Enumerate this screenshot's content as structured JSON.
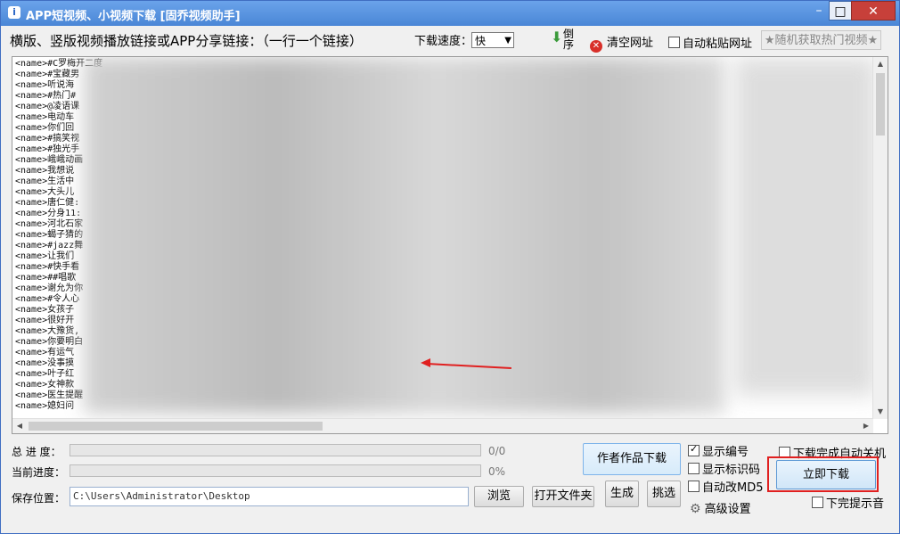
{
  "window": {
    "title": "APP短视频、小视频下载 [固乔视频助手]",
    "controls": {
      "minimize": "–",
      "maximize": "□",
      "close": "✕"
    },
    "icon": "app-icon"
  },
  "toolbar": {
    "main_label": "横版、竖版视频播放链接或APP分享链接：（一行一个链接）",
    "speed_label": "下载速度：",
    "speed_value": "快",
    "reverse_label": "倒序",
    "clear_label": "清空网址",
    "auto_paste_label": "自动粘贴网址",
    "auto_paste_checked": false,
    "hot_label": "★随机获取热门视频★"
  },
  "links": {
    "rows": [
      "<name>#C罗梅开二度",
      "<name>#宝藏男",
      "<name>听说海",
      "<name>#热门#",
      "<name>@凌语课",
      "<name>电动车",
      "<name>你们回",
      "<name>#搞笑视",
      "<name>#独光手",
      "<name>峨峨动画",
      "<name>我想说",
      "<name>生活中",
      "<name>大头儿",
      "<name>唐仁健:",
      "<name>分身11:",
      "<name>河北石家",
      "<name>蝎子猜的",
      "<name>#jazz舞",
      "<name>让我们",
      "<name>#快手看",
      "<name>##唱歌",
      "<name>谢允为你",
      "<name>#令人心",
      "<name>女孩子",
      "<name>很好开",
      "<name>大豫货,",
      "<name>你要明白",
      "<name>有运气",
      "<name>没事摸",
      "<name>叶子红",
      "<name>女神款",
      "<name>医生提醒",
      "<name>媳妇问"
    ]
  },
  "progress": {
    "total_label": "总 进 度：",
    "total_text": "0/0",
    "total_fraction": 0,
    "current_label": "当前进度：",
    "current_text": "0%",
    "current_fraction": 0
  },
  "save": {
    "label": "保存位置：",
    "path": "C:\\Users\\Administrator\\Desktop",
    "browse": "浏览",
    "open_folder": "打开文件夹"
  },
  "actions": {
    "author_download": "作者作品下载",
    "generate": "生成",
    "pick": "挑选",
    "download_now": "立即下载"
  },
  "options": {
    "show_number": {
      "label": "显示编号",
      "checked": true
    },
    "show_watermark": {
      "label": "显示标识码",
      "checked": false
    },
    "auto_md5": {
      "label": "自动改MD5",
      "checked": false
    },
    "advanced": "高级设置",
    "auto_shutdown": {
      "label": "下载完成自动关机",
      "checked": false
    },
    "done_sound": {
      "label": "下完提示音",
      "checked": false
    }
  }
}
